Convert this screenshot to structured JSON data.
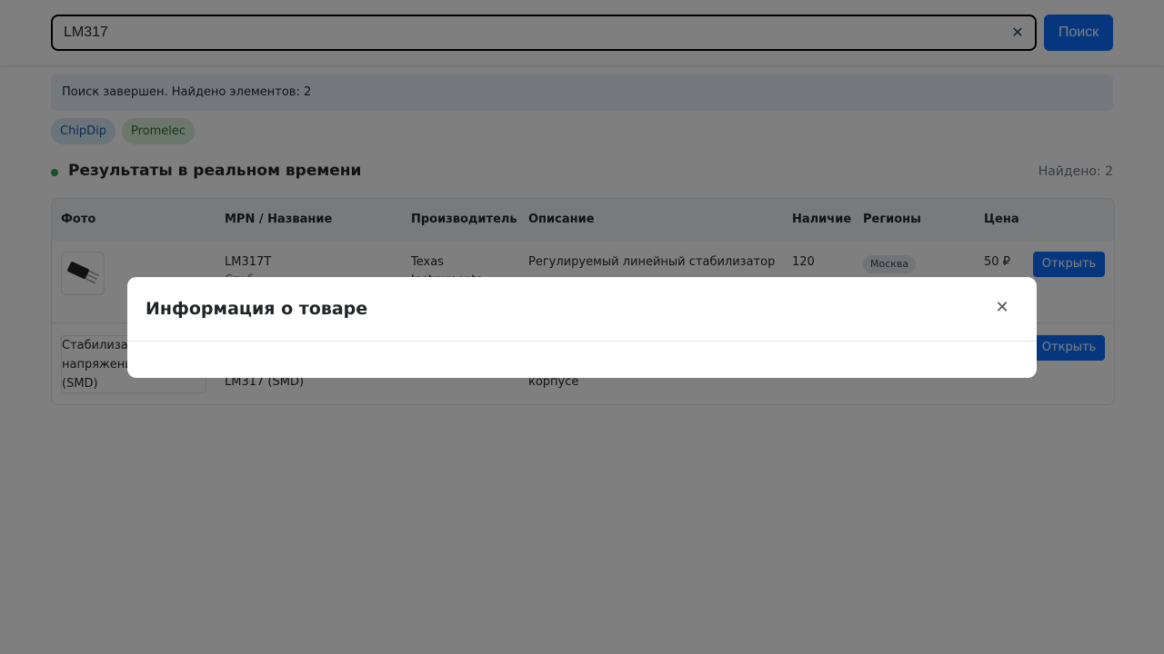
{
  "search": {
    "value": "LM317",
    "clear_icon": "close-icon",
    "button_label": "Поиск"
  },
  "status": {
    "text": "Поиск завершен. Найдено элементов: 2"
  },
  "sources": [
    "ChipDip",
    "Promelec"
  ],
  "results": {
    "title": "Результаты в реальном времени",
    "found_label": "Найдено: 2",
    "columns": [
      "Фото",
      "MPN / Название",
      "Производитель",
      "Описание",
      "Наличие",
      "Регионы",
      "Цена"
    ],
    "rows": [
      {
        "photo": "transistor-image",
        "mpn": "LM317T",
        "name": "Стаб...",
        "manufacturer": "Texas",
        "manufacturer_2": "Instruments",
        "description": "Регулируемый линейный стабилизатор",
        "stock": "120",
        "region": "Москва",
        "price": "50 ₽",
        "action": "Открыть"
      },
      {
        "photo_alt_line1": "Стабилизатор",
        "photo_alt_line2": "напряжения",
        "photo_alt_line3": "(SMD)",
        "name": "LM317 (SMD)",
        "description_line2": "корпусе",
        "action": "Открыть"
      }
    ]
  },
  "modal": {
    "title": "Информация о товаре",
    "close_icon": "close-icon"
  },
  "colors": {
    "accent": "#0d6efd",
    "overlay": "rgba(0,0,0,0.5)"
  }
}
